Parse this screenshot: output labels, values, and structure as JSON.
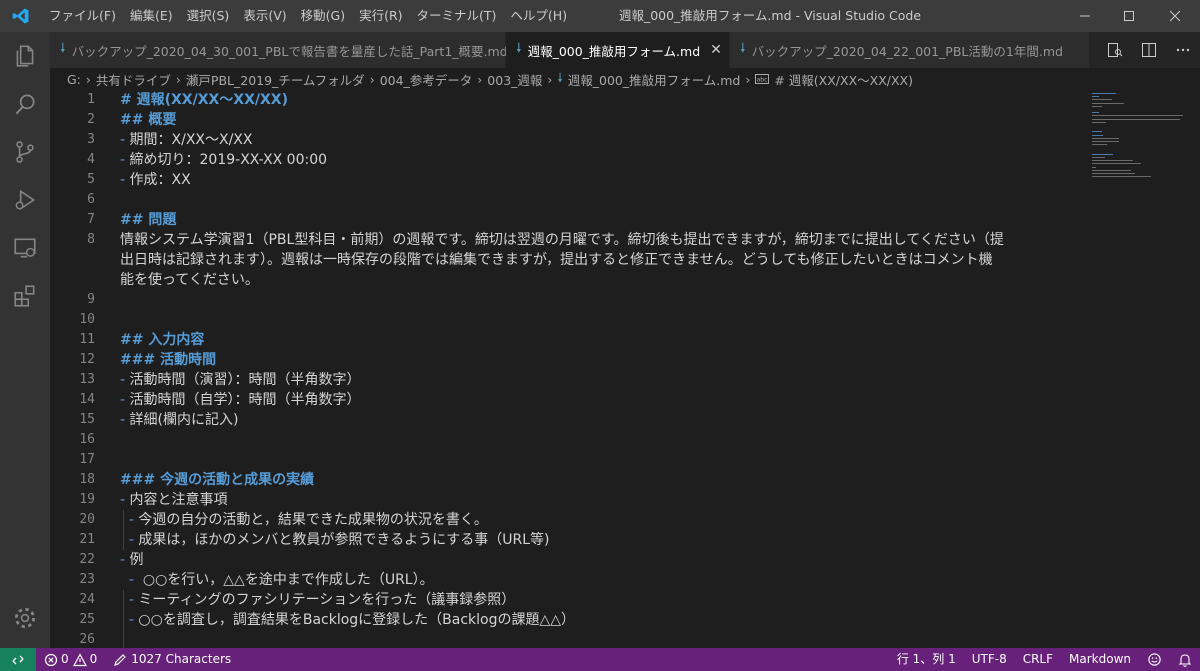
{
  "window": {
    "title": "週報_000_推敲用フォーム.md - Visual Studio Code"
  },
  "menu": [
    "ファイル(F)",
    "編集(E)",
    "選択(S)",
    "表示(V)",
    "移動(G)",
    "実行(R)",
    "ターミナル(T)",
    "ヘルプ(H)"
  ],
  "tabs": [
    {
      "label": "バックアップ_2020_04_30_001_PBLで報告書を量産した話_Part1_概要.md",
      "active": false
    },
    {
      "label": "週報_000_推敲用フォーム.md",
      "active": true
    },
    {
      "label": "バックアップ_2020_04_22_001_PBL活動の1年間.md",
      "active": false
    }
  ],
  "breadcrumb": [
    "G:",
    "共有ドライブ",
    "瀬戸PBL_2019_チームフォルダ",
    "004_参考データ",
    "003_週報",
    "週報_000_推敲用フォーム.md",
    "# 週報(XX/XX〜XX/XX)"
  ],
  "editor": {
    "lines": [
      {
        "n": "1",
        "parts": [
          {
            "t": "# 週報(XX/XX〜XX/XX)",
            "c": "h"
          }
        ]
      },
      {
        "n": "2",
        "parts": [
          {
            "t": "## 概要",
            "c": "h"
          }
        ]
      },
      {
        "n": "3",
        "parts": [
          {
            "t": "- ",
            "c": "bul"
          },
          {
            "t": "期間：X/XX〜X/XX",
            "c": ""
          }
        ]
      },
      {
        "n": "4",
        "parts": [
          {
            "t": "- ",
            "c": "bul"
          },
          {
            "t": "締め切り：2019-XX-XX 00:00",
            "c": ""
          }
        ]
      },
      {
        "n": "5",
        "parts": [
          {
            "t": "- ",
            "c": "bul"
          },
          {
            "t": "作成：XX",
            "c": ""
          }
        ]
      },
      {
        "n": "6",
        "parts": []
      },
      {
        "n": "7",
        "parts": [
          {
            "t": "## 問題",
            "c": "h"
          }
        ]
      },
      {
        "n": "8",
        "parts": [
          {
            "t": "情報システム学演習1（PBL型科目・前期）の週報です。締切は翌週の月曜です。締切後も提出できますが，締切までに提出してください（提",
            "c": ""
          }
        ]
      },
      {
        "n": "",
        "parts": [
          {
            "t": "出日時は記録されます）。週報は一時保存の段階では編集できますが，提出すると修正できません。どうしても修正したいときはコメント機",
            "c": ""
          }
        ]
      },
      {
        "n": "",
        "parts": [
          {
            "t": "能を使ってください。",
            "c": ""
          }
        ]
      },
      {
        "n": "9",
        "parts": []
      },
      {
        "n": "10",
        "parts": []
      },
      {
        "n": "11",
        "parts": [
          {
            "t": "## 入力内容",
            "c": "h"
          }
        ]
      },
      {
        "n": "12",
        "parts": [
          {
            "t": "### 活動時間",
            "c": "h"
          }
        ]
      },
      {
        "n": "13",
        "parts": [
          {
            "t": "- ",
            "c": "bul"
          },
          {
            "t": "活動時間（演習）：時間（半角数字）",
            "c": ""
          }
        ]
      },
      {
        "n": "14",
        "parts": [
          {
            "t": "- ",
            "c": "bul"
          },
          {
            "t": "活動時間（自学）：時間（半角数字）",
            "c": ""
          }
        ]
      },
      {
        "n": "15",
        "parts": [
          {
            "t": "- ",
            "c": "bul"
          },
          {
            "t": "詳細(欄内に記入)",
            "c": ""
          }
        ]
      },
      {
        "n": "16",
        "parts": []
      },
      {
        "n": "17",
        "parts": []
      },
      {
        "n": "18",
        "parts": [
          {
            "t": "### 今週の活動と成果の実績",
            "c": "h"
          }
        ]
      },
      {
        "n": "19",
        "parts": [
          {
            "t": "- ",
            "c": "bul"
          },
          {
            "t": "内容と注意事項",
            "c": ""
          }
        ]
      },
      {
        "n": "20",
        "parts": [
          {
            "t": "  - ",
            "c": "bul"
          },
          {
            "t": "今週の自分の活動と，結果できた成果物の状況を書く。",
            "c": ""
          }
        ]
      },
      {
        "n": "21",
        "parts": [
          {
            "t": "  - ",
            "c": "bul"
          },
          {
            "t": "成果は，ほかのメンバと教員が参照できるようにする事（URL等)",
            "c": ""
          }
        ]
      },
      {
        "n": "22",
        "parts": [
          {
            "t": "- ",
            "c": "bul"
          },
          {
            "t": "例",
            "c": ""
          }
        ]
      },
      {
        "n": "23",
        "parts": [
          {
            "t": "  - ",
            "c": "bul"
          },
          {
            "t": " ○○を行い，△△を途中まで作成した（URL）。",
            "c": ""
          }
        ]
      },
      {
        "n": "24",
        "parts": [
          {
            "t": "  - ",
            "c": "bul"
          },
          {
            "t": "ミーティングのファシリテーションを行った（議事録参照）",
            "c": ""
          }
        ]
      },
      {
        "n": "25",
        "parts": [
          {
            "t": "  - ",
            "c": "bul"
          },
          {
            "t": "○○を調査し，調査結果をBacklogに登録した（Backlogの課題△△）",
            "c": ""
          }
        ]
      },
      {
        "n": "26",
        "parts": []
      }
    ]
  },
  "status": {
    "errors": "0",
    "warnings": "0",
    "characters": "1027 Characters",
    "position": "行 1、列 1",
    "encoding": "UTF-8",
    "eol": "CRLF",
    "language": "Markdown"
  },
  "colors": {
    "status_bar": "#68217a",
    "remote": "#16825d",
    "heading": "#569cd6",
    "accent": "#007acc"
  }
}
